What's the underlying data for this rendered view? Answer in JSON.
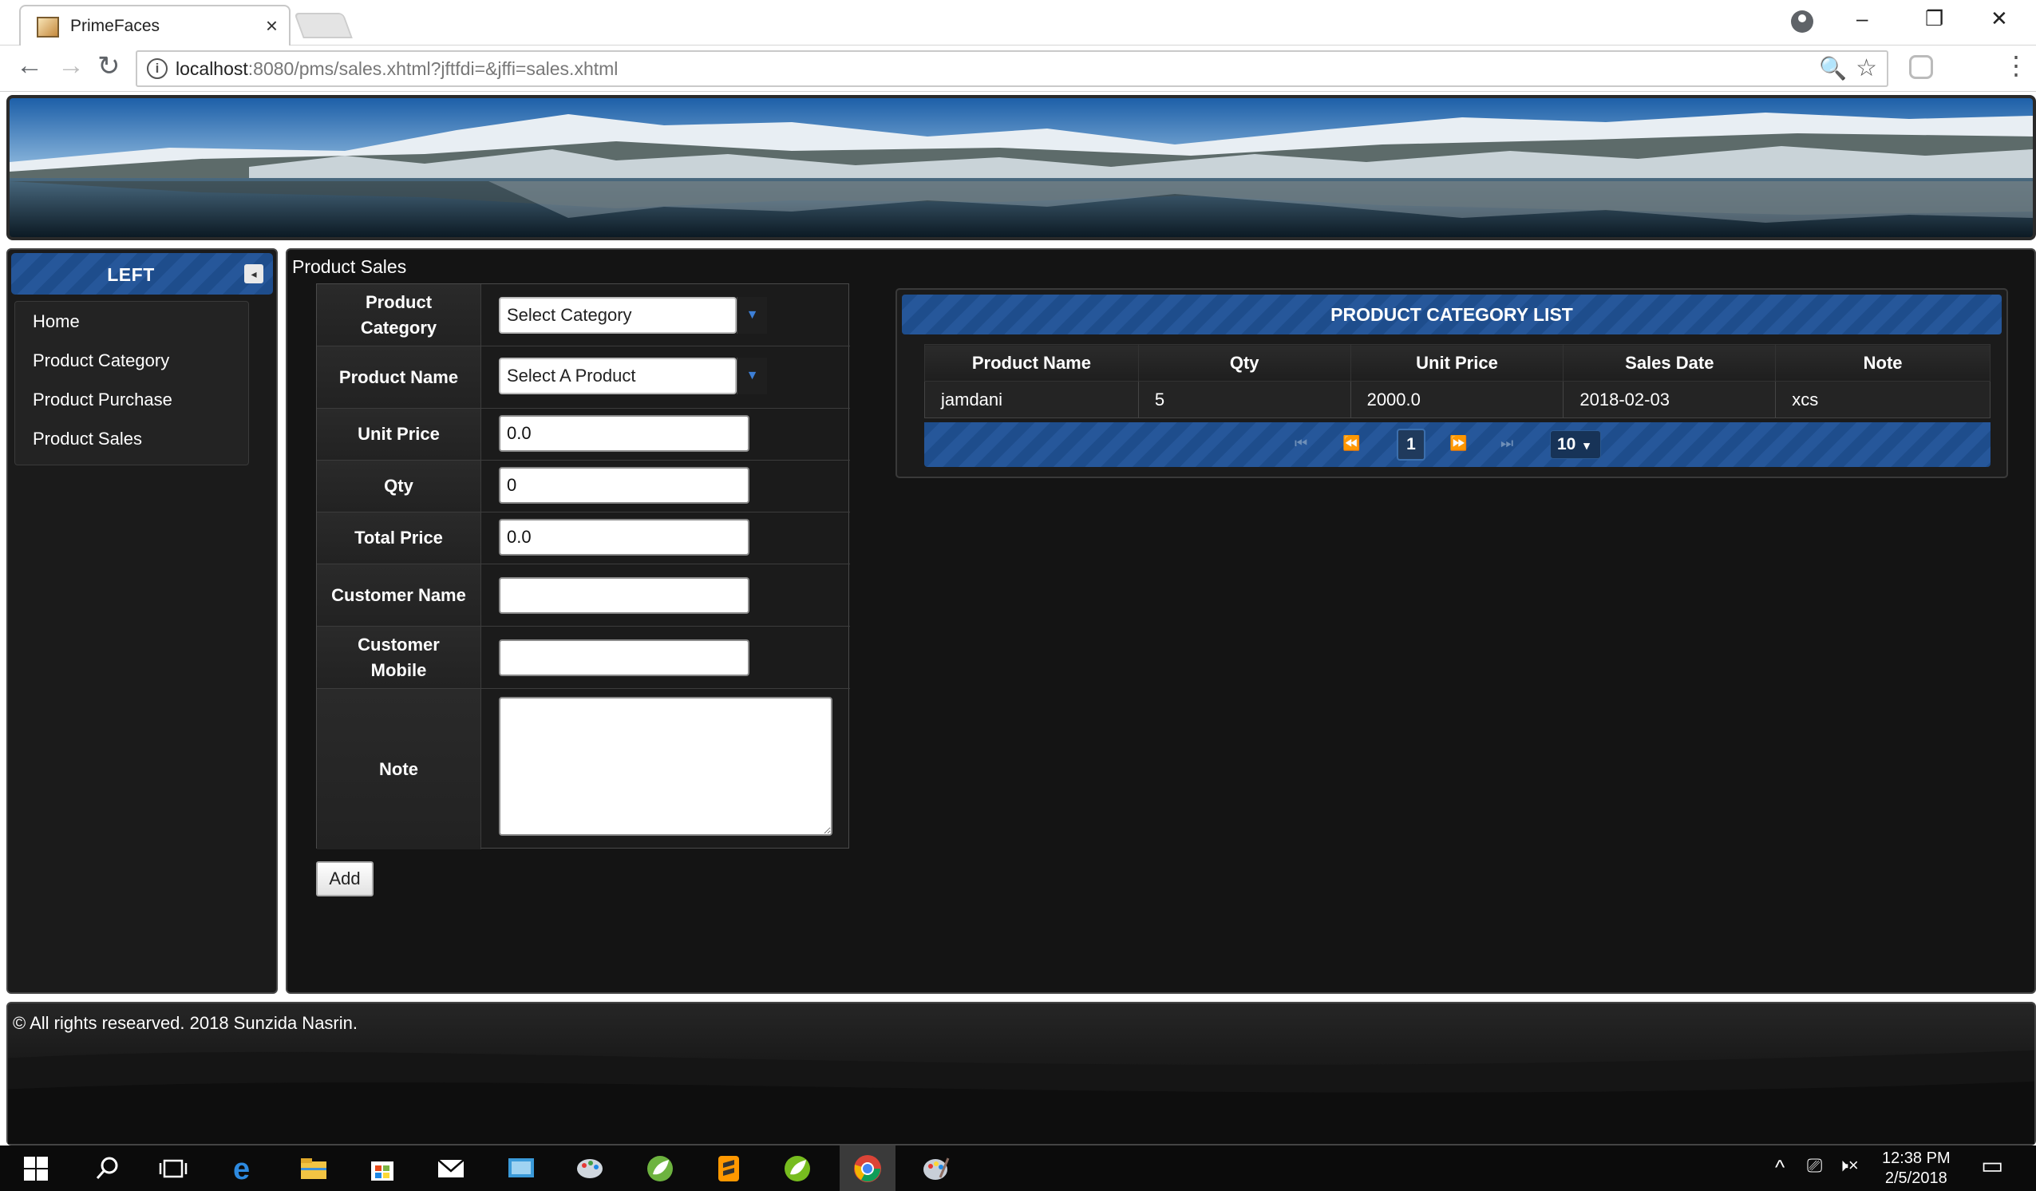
{
  "browser": {
    "tab_title": "PrimeFaces",
    "tab_close": "×",
    "url_host": "localhost",
    "url_rest": ":8080/pms/sales.xhtml?jftfdi=&jffi=sales.xhtml",
    "win_min": "–",
    "win_restore": "❐",
    "win_close": "✕",
    "nav_back": "←",
    "nav_forward": "→",
    "nav_reload": "↻",
    "zoom_icon": "🔍",
    "star_icon": "☆",
    "menu_icon": "⋮",
    "info_icon": "i"
  },
  "layout_west": {
    "title": "LEFT",
    "toggle_icon": "◂",
    "menu": [
      "Home",
      "Product Category",
      "Product Purchase",
      "Product Sales"
    ]
  },
  "center": {
    "panel_title": "Product Sales",
    "form": {
      "category_label": "Product Category",
      "category_selected": "Select Category",
      "product_label": "Product Name",
      "product_selected": "Select A Product",
      "unit_price_label": "Unit Price",
      "unit_price_value": "0.0",
      "qty_label": "Qty",
      "qty_value": "0",
      "total_price_label": "Total Price",
      "total_price_value": "0.0",
      "customer_name_label": "Customer Name",
      "customer_name_value": "",
      "customer_mobile_label": "Customer Mobile",
      "customer_mobile_value": "",
      "note_label": "Note",
      "dropdown_icon": "▼",
      "add_button": "Add"
    },
    "datatable": {
      "title": "PRODUCT CATEGORY LIST",
      "columns": [
        "Product Name",
        "Qty",
        "Unit Price",
        "Sales Date",
        "Note"
      ],
      "rows": [
        [
          "jamdani",
          "5",
          "2000.0",
          "2018-02-03",
          "xcs"
        ]
      ],
      "paginator": {
        "first": "⏮",
        "prev": "⏪",
        "current_page": "1",
        "next": "⏩",
        "last": "⏭",
        "rows_per_page": "10",
        "rows_dropdown_icon": "▾"
      }
    }
  },
  "footer": {
    "text": "© All rights researved. 2018 Sunzida Nasrin."
  },
  "taskbar": {
    "time": "12:38 PM",
    "date": "2/5/2018",
    "tray_up": "^",
    "tray_network": "⎚",
    "tray_volume": "🕨×",
    "notification_icon": "▭"
  },
  "colors": {
    "accent_blue": "#1e4d8c",
    "panel_dark": "#141414",
    "taskbar": "#0b0b0b"
  }
}
